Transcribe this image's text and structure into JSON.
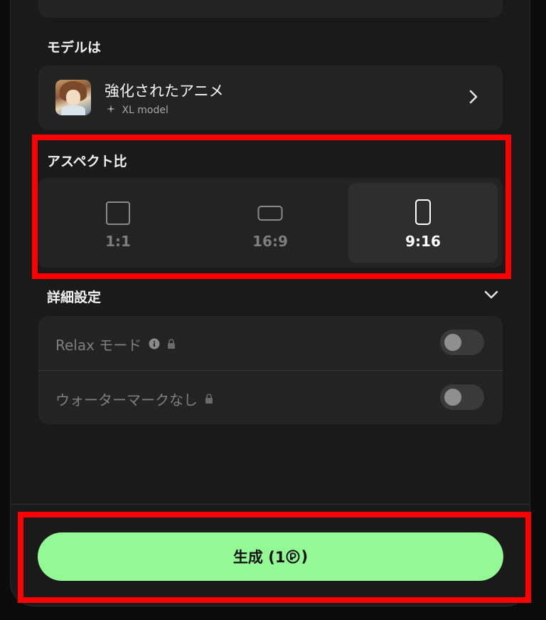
{
  "model_section": {
    "heading": "モデルは",
    "model_name": "強化されたアニメ",
    "model_tag": "XL model"
  },
  "aspect_section": {
    "heading": "アスペクト比",
    "options": [
      {
        "label": "1:1",
        "selected": false
      },
      {
        "label": "16:9",
        "selected": false
      },
      {
        "label": "9:16",
        "selected": true
      }
    ]
  },
  "details_section": {
    "heading": "詳細設定",
    "settings": [
      {
        "label": "Relax モード",
        "enabled": false
      },
      {
        "label": "ウォーターマークなし",
        "enabled": false
      }
    ]
  },
  "generate_button": {
    "label": "生成 (1",
    "suffix": ")"
  },
  "colors": {
    "accent": "#93f995",
    "highlight": "#ff0000",
    "panel": "#1a1a1a",
    "card": "#232323"
  }
}
